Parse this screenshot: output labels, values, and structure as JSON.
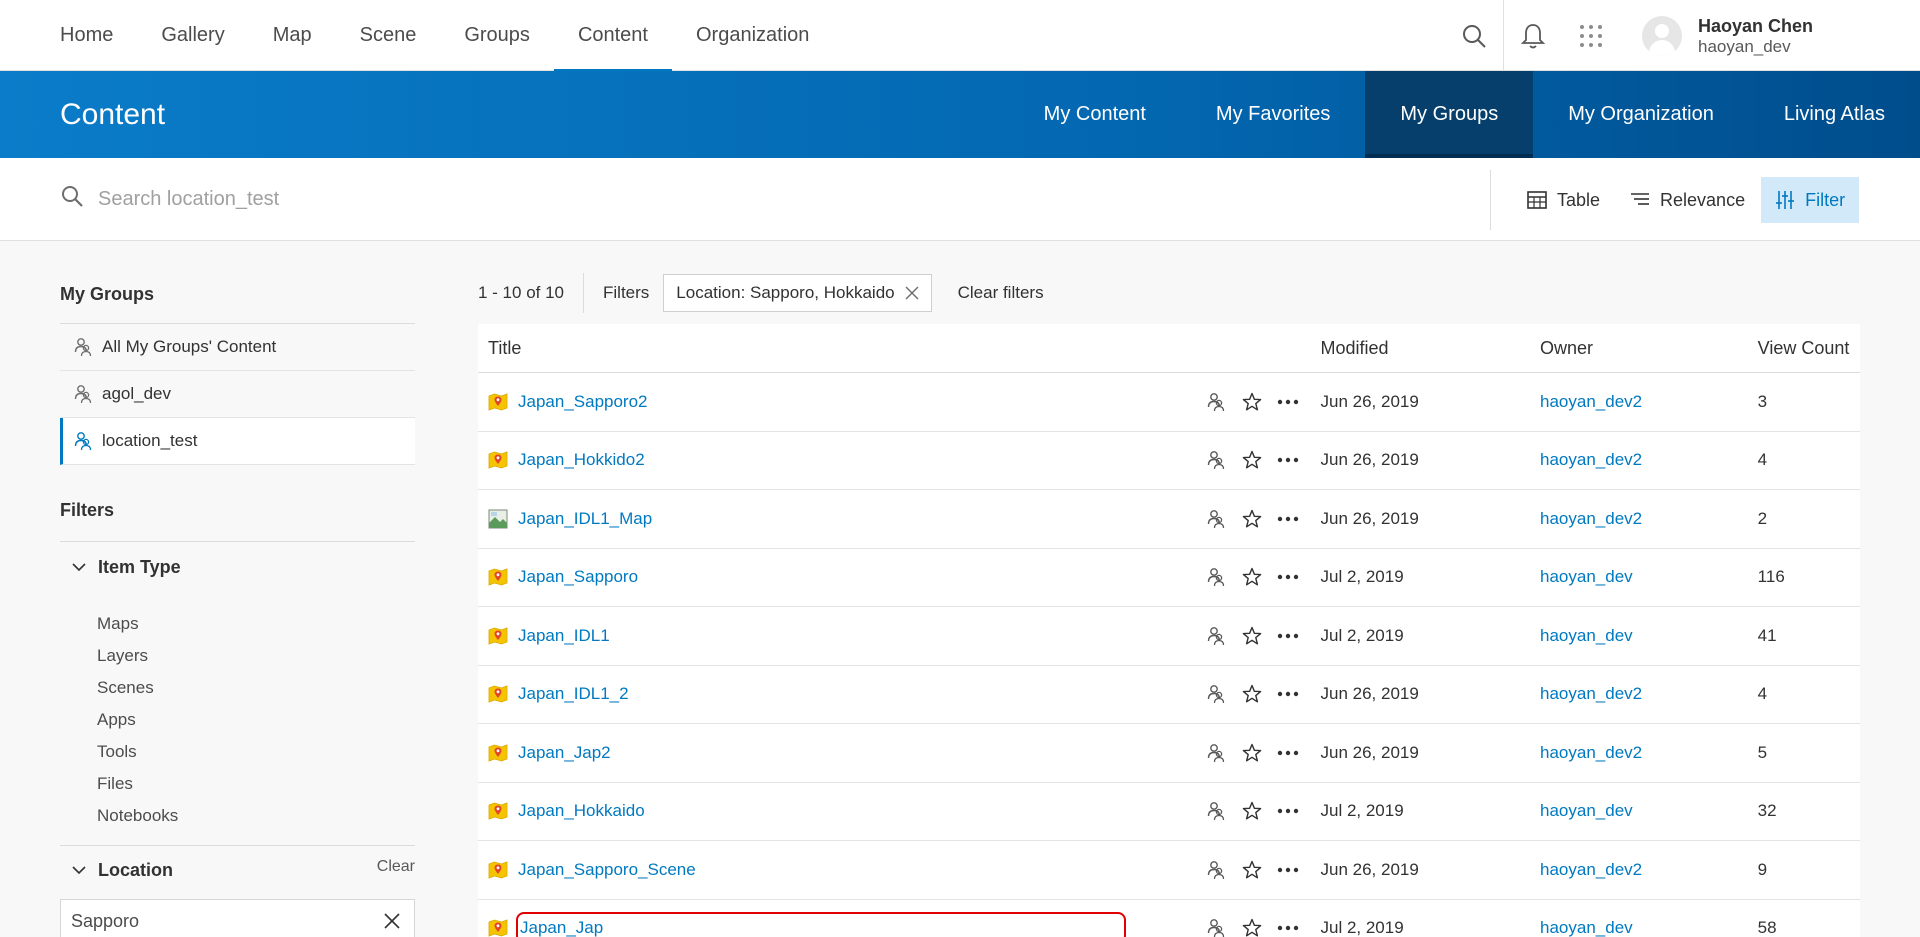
{
  "topnav": {
    "links": [
      "Home",
      "Gallery",
      "Map",
      "Scene",
      "Groups",
      "Content",
      "Organization"
    ],
    "active": "Content"
  },
  "user": {
    "name": "Haoyan Chen",
    "handle": "haoyan_dev"
  },
  "header": {
    "title": "Content",
    "tabs": [
      "My Content",
      "My Favorites",
      "My Groups",
      "My Organization",
      "Living Atlas"
    ],
    "active_tab": "My Groups"
  },
  "search": {
    "placeholder": "Search location_test",
    "value": ""
  },
  "view_tools": {
    "table_label": "Table",
    "sort_label": "Relevance",
    "filter_label": "Filter"
  },
  "sidebar": {
    "groups_heading": "My Groups",
    "groups": [
      {
        "label": "All My Groups' Content",
        "active": false
      },
      {
        "label": "agol_dev",
        "active": false
      },
      {
        "label": "location_test",
        "active": true
      }
    ],
    "filters_heading": "Filters",
    "item_type_heading": "Item Type",
    "item_types": [
      "Maps",
      "Layers",
      "Scenes",
      "Apps",
      "Tools",
      "Files",
      "Notebooks"
    ],
    "location_heading": "Location",
    "location_clear": "Clear",
    "location_value": "Sapporo"
  },
  "results": {
    "count": "1 - 10 of 10",
    "filters_label": "Filters",
    "chip": "Location: Sapporo, Hokkaido",
    "clear_filters": "Clear filters",
    "columns": {
      "title": "Title",
      "modified": "Modified",
      "owner": "Owner",
      "views": "View Count"
    },
    "rows": [
      {
        "title": "Japan_Sapporo2",
        "type_icon": "web-map-icon",
        "modified": "Jun 26, 2019",
        "owner": "haoyan_dev2",
        "views": "3"
      },
      {
        "title": "Japan_Hokkido2",
        "type_icon": "web-map-icon",
        "modified": "Jun 26, 2019",
        "owner": "haoyan_dev2",
        "views": "4"
      },
      {
        "title": "Japan_IDL1_Map",
        "type_icon": "map-image-icon",
        "modified": "Jun 26, 2019",
        "owner": "haoyan_dev2",
        "views": "2"
      },
      {
        "title": "Japan_Sapporo",
        "type_icon": "web-map-icon",
        "modified": "Jul 2, 2019",
        "owner": "haoyan_dev",
        "views": "116"
      },
      {
        "title": "Japan_IDL1",
        "type_icon": "web-map-icon",
        "modified": "Jul 2, 2019",
        "owner": "haoyan_dev",
        "views": "41"
      },
      {
        "title": "Japan_IDL1_2",
        "type_icon": "web-map-icon",
        "modified": "Jun 26, 2019",
        "owner": "haoyan_dev2",
        "views": "4"
      },
      {
        "title": "Japan_Jap2",
        "type_icon": "web-map-icon",
        "modified": "Jun 26, 2019",
        "owner": "haoyan_dev2",
        "views": "5"
      },
      {
        "title": "Japan_Hokkaido",
        "type_icon": "web-map-icon",
        "modified": "Jul 2, 2019",
        "owner": "haoyan_dev",
        "views": "32"
      },
      {
        "title": "Japan_Sapporo_Scene",
        "type_icon": "web-map-icon",
        "modified": "Jun 26, 2019",
        "owner": "haoyan_dev2",
        "views": "9"
      },
      {
        "title": "Japan_Jap",
        "type_icon": "web-map-icon",
        "modified": "Jul 2, 2019",
        "owner": "haoyan_dev",
        "views": "58",
        "selected": true
      }
    ]
  },
  "colors": {
    "accent": "#0079c1",
    "header_dark": "#063f6c",
    "selection": "#e00000",
    "map_icon": "#f5c400"
  }
}
